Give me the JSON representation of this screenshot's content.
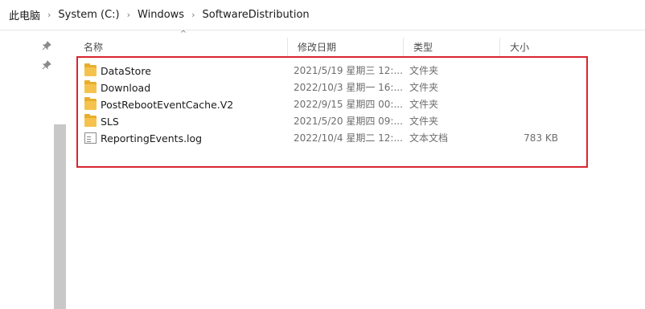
{
  "breadcrumb": {
    "items": [
      "此电脑",
      "System (C:)",
      "Windows",
      "SoftwareDistribution"
    ],
    "separator": "›"
  },
  "columns": {
    "name": "名称",
    "date": "修改日期",
    "type": "类型",
    "size": "大小",
    "sort_indicator": "^"
  },
  "files": [
    {
      "name": "DataStore",
      "date": "2021/5/19 星期三 12:...",
      "type": "文件夹",
      "size": "",
      "icon": "folder-icon"
    },
    {
      "name": "Download",
      "date": "2022/10/3 星期一 16:...",
      "type": "文件夹",
      "size": "",
      "icon": "folder-icon"
    },
    {
      "name": "PostRebootEventCache.V2",
      "date": "2022/9/15 星期四 00:...",
      "type": "文件夹",
      "size": "",
      "icon": "folder-icon"
    },
    {
      "name": "SLS",
      "date": "2021/5/20 星期四 09:...",
      "type": "文件夹",
      "size": "",
      "icon": "folder-icon"
    },
    {
      "name": "ReportingEvents.log",
      "date": "2022/10/4 星期二 12:...",
      "type": "文本文档",
      "size": "783 KB",
      "icon": "text-document-icon"
    }
  ],
  "colors": {
    "highlight_border": "#d9252f",
    "folder": "#f5c34d"
  }
}
